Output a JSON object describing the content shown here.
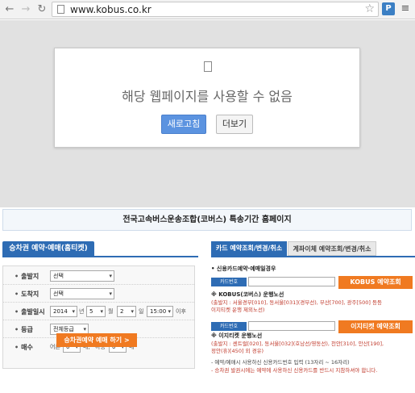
{
  "browser": {
    "back": "←",
    "forward": "→",
    "reload": "↻",
    "url": "www.kobus.co.kr",
    "star": "☆",
    "extension_label": "P",
    "menu": "≡"
  },
  "error": {
    "message": "해당 웹페이지를 사용할 수 없음",
    "reload_label": "새로고침",
    "more_label": "더보기"
  },
  "site": {
    "banner_title": "전국고속버스운송조합(코버스) 특송기간 홈페이지",
    "left_tab": "승차권 예약·예매(홈티켓)",
    "form": {
      "depart_label": "출발지",
      "depart_value": "선택",
      "arrive_label": "도착지",
      "arrive_value": "선택",
      "datetime_label": "출발일시",
      "year_value": "2014",
      "year_unit": "년",
      "month_value": "5",
      "month_unit": "월",
      "day_value": "2",
      "day_unit": "일",
      "time_value": "15:00",
      "time_unit": "이후",
      "grade_label": "등급",
      "grade_value": "전체등급",
      "count_label": "매수",
      "adult_label": "어른",
      "adult_value": "0",
      "adult_unit": "매,",
      "child_label": "아동",
      "child_value": "0",
      "child_unit": "매"
    },
    "book_button": "승차권예약 예매 하기 >",
    "right_tab_active": "카드 예약조회/변경/취소",
    "right_tab_other": "계좌이체 예약조회/변경/취소",
    "card_heading": "• 신용카드예약·예매일경우",
    "card_label": "카드번호",
    "kobus_button": "KOBUS 예약조회",
    "kobus_route_title": "※ KOBUS(코버스) 운행노선",
    "kobus_route_line1": "(출발지 : 서울경부[010], 동서울[031](경부선), 부산[700], 광주[500] 등등",
    "kobus_route_line2": "이지티켓 운행 제외노선)",
    "easy_label": "카드번호",
    "easy_button": "이지티켓 예약조회",
    "easy_route_title": "※ 이지티켓 운행노선",
    "easy_route_line1": "(출발지 : 센트럴[020], 동서울[032](호남선/영동선), 천안[310], 안산[190],",
    "easy_route_line2": "정안(휴)[450] 외 경유)",
    "note1": "- 예약/예매시 사용하신 신용카드번호 입력 (13자리 ~ 16자리)",
    "note2": "- 승차권 발권시에는 예약에 사용하신 신용카드를 반드시 지참하셔야 합니다."
  }
}
